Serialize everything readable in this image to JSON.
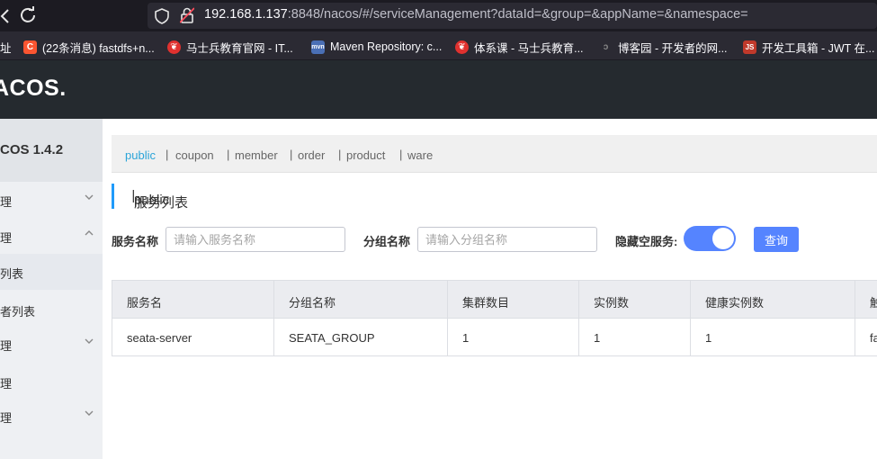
{
  "browser": {
    "url_host": "192.168.1.137",
    "url_rest": ":8848/nacos/#/serviceManagement?dataId=&group=&appName=&namespace=",
    "bookmarks": [
      {
        "label": "址",
        "icon": "folder-icon",
        "color": ""
      },
      {
        "label": "(22条消息) fastdfs+n...",
        "icon": "csdn-icon",
        "color": "#fc5531"
      },
      {
        "label": "马士兵教育官网 - IT...",
        "icon": "mashibing-icon",
        "color": "#e0312f"
      },
      {
        "label": "Maven Repository: c...",
        "icon": "maven-icon",
        "color": "#4a6fb5"
      },
      {
        "label": "体系课 - 马士兵教育...",
        "icon": "mashibing-icon",
        "color": "#e0312f"
      },
      {
        "label": "博客园 - 开发者的网...",
        "icon": "cnblogs-icon",
        "color": "#444444"
      },
      {
        "label": "开发工具箱 - JWT 在...",
        "icon": "js-icon",
        "color": "#c0392b"
      }
    ]
  },
  "header": {
    "logo": "ACOS."
  },
  "sidebar": {
    "title": "COS 1.4.2",
    "items": [
      {
        "label": "理",
        "chevron": "down"
      },
      {
        "label": "理",
        "chevron": "up"
      },
      {
        "label": "列表",
        "chevron": ""
      },
      {
        "label": "者列表",
        "chevron": ""
      },
      {
        "label": "理",
        "chevron": "down"
      },
      {
        "label": "理",
        "chevron": ""
      },
      {
        "label": "理",
        "chevron": "down"
      }
    ]
  },
  "namespaces": [
    "public",
    "coupon",
    "member",
    "order",
    "product",
    "ware"
  ],
  "page": {
    "title": "服务列表",
    "namespace": "public"
  },
  "filters": {
    "service_label": "服务名称",
    "service_placeholder": "请输入服务名称",
    "group_label": "分组名称",
    "group_placeholder": "请输入分组名称",
    "hide_empty_label": "隐藏空服务:",
    "hide_empty_on": true,
    "query_label": "查询"
  },
  "table": {
    "columns": [
      "服务名",
      "分组名称",
      "集群数目",
      "实例数",
      "健康实例数",
      "触"
    ],
    "rows": [
      [
        "seata-server",
        "SEATA_GROUP",
        "1",
        "1",
        "1",
        "fa"
      ]
    ]
  },
  "colors": {
    "accent": "#5584ff",
    "active_ns": "#2aa4d8",
    "header_bg": "#252a2f"
  }
}
